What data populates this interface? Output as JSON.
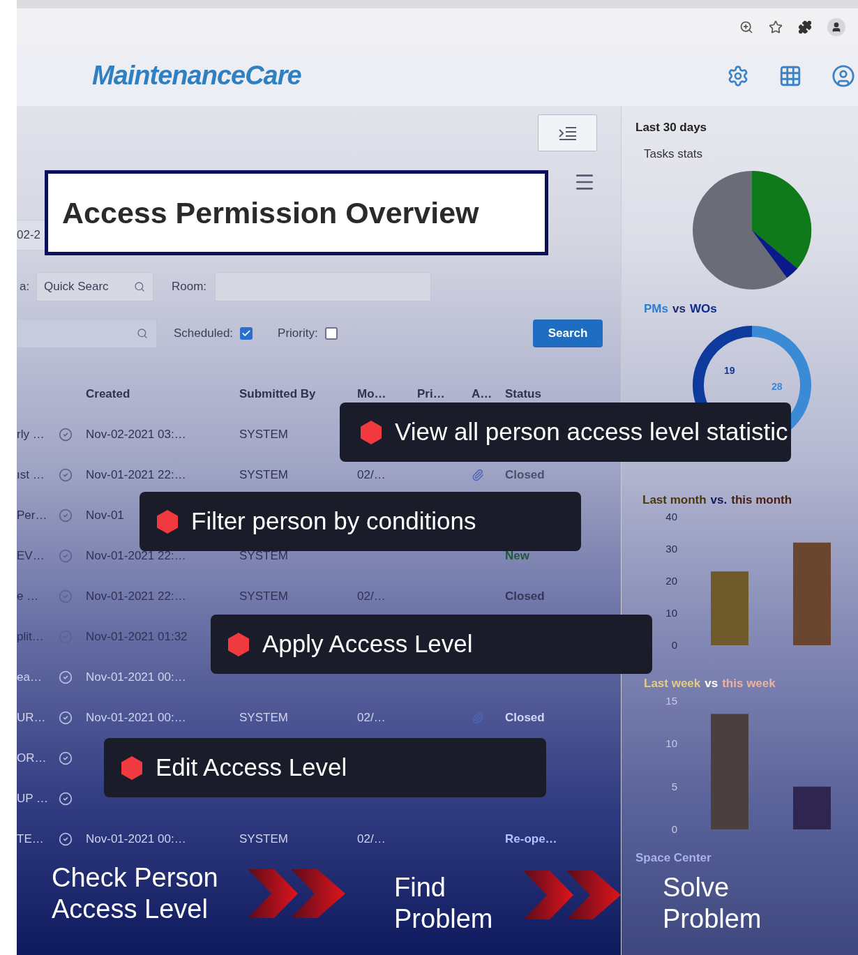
{
  "app": {
    "logo": "MaintenanceCare"
  },
  "overview_title": "Access Permission Overview",
  "date_field": {
    "value": "02-2"
  },
  "filters": {
    "area_label": "a:",
    "quick_search": {
      "placeholder": "Quick Searc"
    },
    "room_label": "Room:",
    "scheduled": {
      "label": "Scheduled:",
      "checked": true
    },
    "priority": {
      "label": "Priority:",
      "checked": false
    },
    "search_button": "Search"
  },
  "table": {
    "columns": [
      "Created",
      "Submitted By",
      "Mo…",
      "Pri…",
      "A…",
      "Status"
    ],
    "rows": [
      {
        "column_1": "rly …",
        "created": "Nov-02-2021 03:…",
        "submitted_by": "SYSTEM"
      },
      {
        "column_1": "ıst …",
        "created": "Nov-01-2021 22:…",
        "submitted_by": "SYSTEM",
        "mo": "02/…",
        "attachment": true,
        "status": "Closed",
        "color": "#4a4f6e"
      },
      {
        "column_1": "Per…",
        "created": "Nov-01"
      },
      {
        "column_1": "EV…",
        "created": "Nov-01-2021 22:…",
        "submitted_by": "SYSTEM",
        "status": "New",
        "color": "#1d5a35"
      },
      {
        "column_1": "e …",
        "created": "Nov-01-2021 22:…",
        "submitted_by": "SYSTEM",
        "mo": "02/…",
        "status": "Closed",
        "color": "#33385a"
      },
      {
        "column_1": "plit…",
        "created": "Nov-01-2021 01:32"
      },
      {
        "column_1": "ea…",
        "created": "Nov-01-2021 00:…"
      },
      {
        "column_1": "UR…",
        "created": "Nov-01-2021 00:…",
        "submitted_by": "SYSTEM",
        "mo": "02/…",
        "attachment": true,
        "status": "Closed",
        "color": "#d4d8f2"
      },
      {
        "column_1": "OR…"
      },
      {
        "column_1": "UP …"
      },
      {
        "column_1": "TE…",
        "created": "Nov-01-2021 00:…",
        "submitted_by": "SYSTEM",
        "mo": "02/…",
        "status": "Re-ope…",
        "color": "#b4c0ff"
      }
    ]
  },
  "sidebar": {
    "heading": "Last 30 days",
    "tasks_title": "Tasks stats",
    "pms_wos": {
      "joiner": "vs",
      "chart_data": {
        "type": "donut",
        "categories": [
          "PMs",
          "WOs"
        ],
        "values": [
          28,
          19
        ],
        "data_labels": true
      }
    },
    "month_chart": {
      "joiner": "vs.",
      "chart_data": {
        "type": "bar",
        "series": [
          {
            "name": "Last month",
            "color": "#6e5a2a",
            "values": [
              23,
              null
            ]
          },
          {
            "name": "this month",
            "color": "#6a4530",
            "values": [
              null,
              32
            ]
          }
        ],
        "stacked": true,
        "ylim": [
          0,
          40
        ],
        "yticks": [
          0,
          10,
          20,
          30,
          40
        ]
      }
    },
    "week_chart": {
      "joiner": "vs",
      "chart_data": {
        "type": "bar",
        "series": [
          {
            "name": "Last week",
            "color": "#4a4040",
            "values": [
              13.5,
              null
            ]
          },
          {
            "name": "this week",
            "color": "#2e2550",
            "values": [
              null,
              5
            ]
          }
        ],
        "stacked": true,
        "ylim": [
          0,
          15
        ],
        "yticks": [
          0,
          5,
          10,
          15
        ]
      }
    },
    "space_title": "Space Center"
  },
  "callouts": [
    {
      "text": "View all person access level statistic"
    },
    {
      "text": "Filter person by conditions"
    },
    {
      "text": "Apply Access Level"
    },
    {
      "text": "Edit Access Level"
    }
  ],
  "steps": [
    "Check Person Access Level",
    "Find Problem",
    "Solve Problem"
  ]
}
